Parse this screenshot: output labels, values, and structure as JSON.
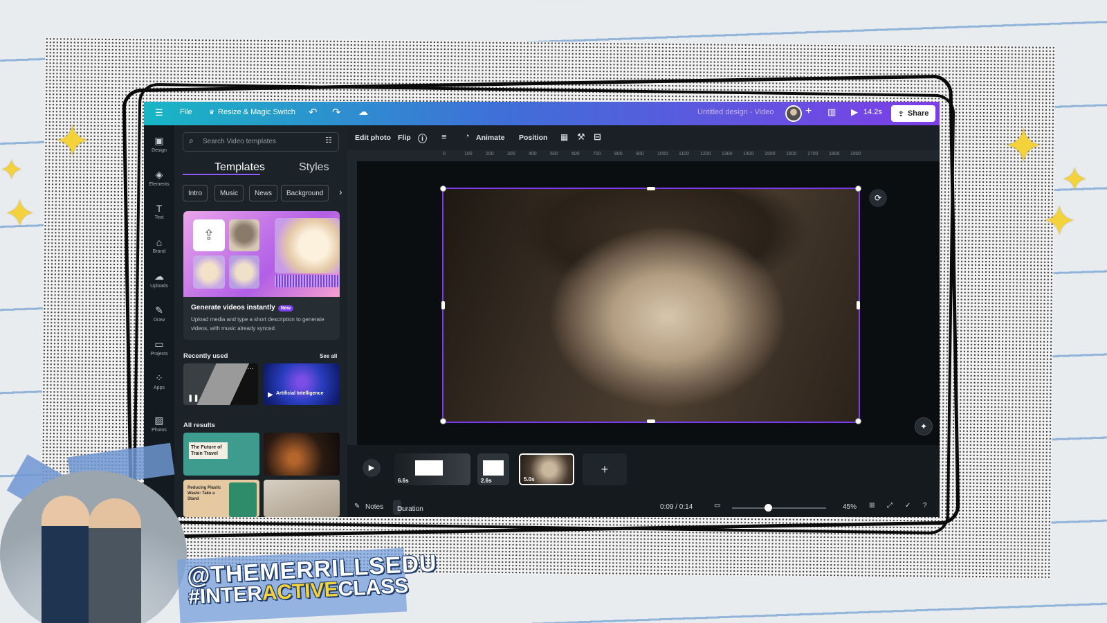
{
  "topbar": {
    "file": "File",
    "resize": "Resize & Magic Switch",
    "title": "Untitled design - Video",
    "play_time": "14.2s",
    "share": "Share"
  },
  "rail": [
    {
      "label": "Design",
      "icon": "design-icon"
    },
    {
      "label": "Elements",
      "icon": "elements-icon"
    },
    {
      "label": "Text",
      "icon": "text-icon"
    },
    {
      "label": "Brand",
      "icon": "brand-icon"
    },
    {
      "label": "Uploads",
      "icon": "uploads-icon"
    },
    {
      "label": "Draw",
      "icon": "draw-icon"
    },
    {
      "label": "Projects",
      "icon": "projects-icon"
    },
    {
      "label": "Apps",
      "icon": "apps-icon"
    },
    {
      "label": "Photos",
      "icon": "photos-icon"
    }
  ],
  "panel": {
    "search_placeholder": "Search Video templates",
    "tabs": [
      "Templates",
      "Styles"
    ],
    "chips": [
      "Intro",
      "Music",
      "News",
      "Background"
    ],
    "promo_title": "Generate videos instantly",
    "promo_badge": "New",
    "promo_desc": "Upload media and type a short description to generate videos, with music already synced.",
    "recent_title": "Recently used",
    "see_all": "See all",
    "recent_ai_label": "Artificial Intelligence",
    "results_title": "All results",
    "result_1": "The Future of Train Travel",
    "result_3": "Reducing Plastic Waste: Take a Stand"
  },
  "context_toolbar": {
    "edit_photo": "Edit photo",
    "flip": "Flip",
    "animate": "Animate",
    "position": "Position"
  },
  "ruler_ticks": [
    "0",
    "100",
    "200",
    "300",
    "400",
    "500",
    "600",
    "700",
    "800",
    "900",
    "1000",
    "1100",
    "1200",
    "1300",
    "1400",
    "1500",
    "1600",
    "1700",
    "1800",
    "1900"
  ],
  "timeline": {
    "clips": [
      {
        "duration": "6.6s"
      },
      {
        "duration": "2.6s"
      },
      {
        "duration": "5.0s"
      }
    ]
  },
  "bottombar": {
    "notes": "Notes",
    "duration": "Duration",
    "time": "0:09 / 0:14",
    "zoom": "45%",
    "zoom_fraction": 0.38
  },
  "overlay": {
    "handle": "@THEMERRILLSEDU",
    "tag_pre": "#INTER",
    "tag_hi": "ACTIVE",
    "tag_post": "CLASS"
  },
  "colors": {
    "accent": "#7c3aed",
    "topbar_start": "#18b6c4",
    "topbar_end": "#7d3ee6",
    "sparkle": "#f4d23c"
  }
}
